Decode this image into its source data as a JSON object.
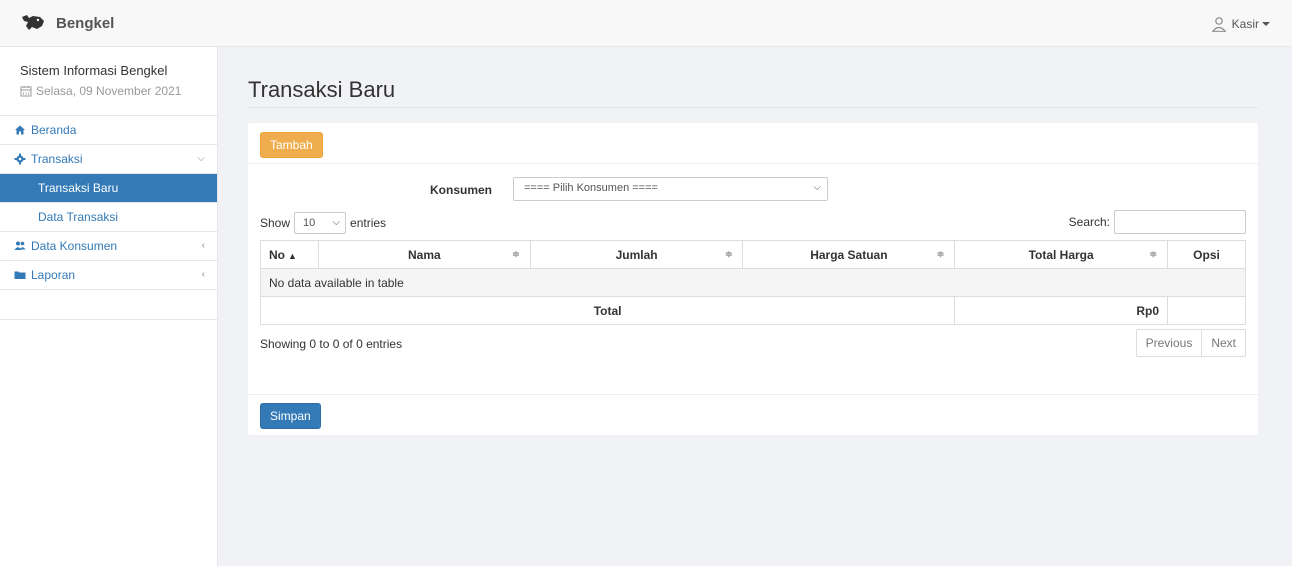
{
  "app": {
    "brand": "Bengkel",
    "user": "Kasir"
  },
  "sidebar": {
    "title": "Sistem Informasi Bengkel",
    "date": "Selasa, 09 November 2021",
    "items": [
      {
        "label": "Beranda",
        "icon": "home-icon"
      },
      {
        "label": "Transaksi",
        "icon": "gear-icon"
      },
      {
        "label": "Transaksi Baru"
      },
      {
        "label": "Data Transaksi"
      },
      {
        "label": "Data Konsumen",
        "icon": "users-icon"
      },
      {
        "label": "Laporan",
        "icon": "folder-icon"
      }
    ]
  },
  "main": {
    "title": "Transaksi Baru",
    "add_button": "Tambah",
    "konsumen_label": "Konsumen",
    "konsumen_placeholder": "==== Pilih Konsumen ====",
    "show_label": "Show",
    "entries_value": "10",
    "entries_label": "entries",
    "search_label": "Search:",
    "table": {
      "headers": [
        "No",
        "Nama",
        "Jumlah",
        "Harga Satuan",
        "Total Harga",
        "Opsi"
      ],
      "empty": "No data available in table",
      "total_label": "Total",
      "total_value": "Rp0"
    },
    "info": "Showing 0 to 0 of 0 entries",
    "prev": "Previous",
    "next": "Next",
    "save_button": "Simpan"
  },
  "colors": {
    "primary": "#337ab7",
    "warning": "#f0ad4e",
    "background": "#f0f2f5"
  }
}
